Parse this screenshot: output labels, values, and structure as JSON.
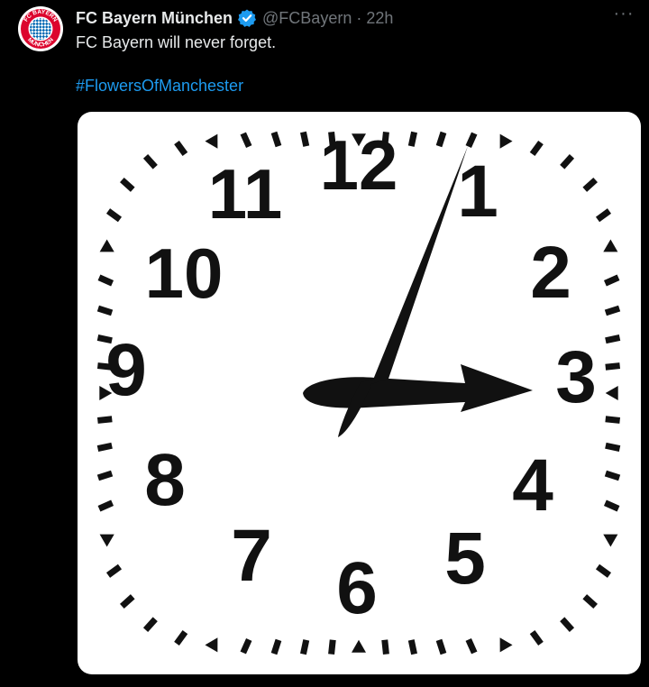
{
  "tweet": {
    "author_name": "FC Bayern München",
    "handle": "@FCBayern",
    "separator": "·",
    "time": "22h",
    "more_label": "···",
    "text": "FC Bayern will never forget.",
    "hashtag": "#FlowersOfManchester"
  },
  "avatar": {
    "logo_text_top": "FC BAYERN",
    "logo_text_bottom": "MÜNCHEN"
  },
  "colors": {
    "background": "#000000",
    "text": "#e7e9ea",
    "secondary": "#71767b",
    "link": "#1d9bf0",
    "verified": "#1d9bf0",
    "bayern_red": "#dc052d",
    "bayern_blue": "#0066b2"
  },
  "clock": {
    "numerals": [
      "12",
      "1",
      "2",
      "3",
      "4",
      "5",
      "6",
      "7",
      "8",
      "9",
      "10",
      "11"
    ],
    "time_shown": "3:03"
  }
}
